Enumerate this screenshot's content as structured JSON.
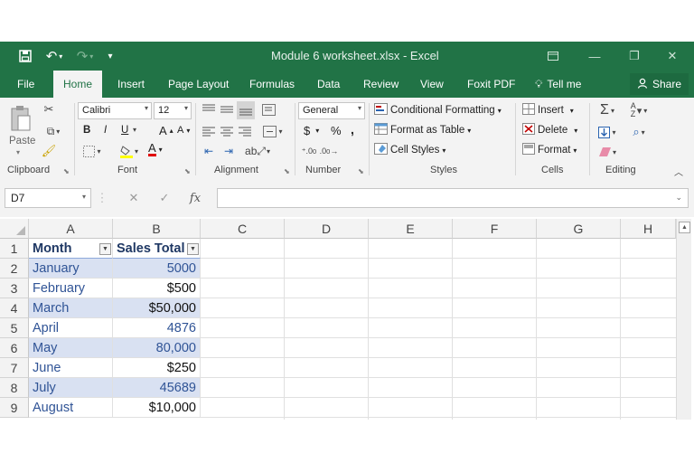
{
  "window": {
    "title": "Module 6 worksheet.xlsx  -  Excel"
  },
  "tabs": [
    "File",
    "Home",
    "Insert",
    "Page Layout",
    "Formulas",
    "Data",
    "Review",
    "View",
    "Foxit PDF"
  ],
  "tell_me": "Tell me",
  "share": "Share",
  "ribbon": {
    "clipboard": {
      "paste": "Paste",
      "label": "Clipboard"
    },
    "font": {
      "name": "Calibri",
      "size": "12",
      "bold": "B",
      "italic": "I",
      "underline": "U",
      "grow": "A",
      "shrink": "A",
      "font_color_letter": "A",
      "label": "Font"
    },
    "alignment": {
      "label": "Alignment"
    },
    "number": {
      "format": "General",
      "currency": "$",
      "percent": "%",
      "comma": ",",
      "label": "Number"
    },
    "styles": {
      "conditional": "Conditional Formatting",
      "format_table": "Format as Table",
      "cell_styles": "Cell Styles",
      "label": "Styles"
    },
    "cells": {
      "insert": "Insert",
      "delete": "Delete",
      "format": "Format",
      "label": "Cells"
    },
    "editing": {
      "label": "Editing"
    }
  },
  "formula_bar": {
    "name_box": "D7",
    "fx": "fx",
    "value": ""
  },
  "sheet": {
    "columns": [
      "A",
      "B",
      "C",
      "D",
      "E",
      "F",
      "G",
      "H"
    ],
    "rows": [
      "1",
      "2",
      "3",
      "4",
      "5",
      "6",
      "7",
      "8",
      "9"
    ],
    "headers": [
      "Month",
      "Sales Total"
    ],
    "data": [
      [
        "January",
        "5000"
      ],
      [
        "February",
        "$500"
      ],
      [
        "March",
        "$50,000"
      ],
      [
        "April",
        "4876"
      ],
      [
        "May",
        "80,000"
      ],
      [
        "June",
        "$250"
      ],
      [
        "July",
        "45689"
      ],
      [
        "August",
        "$10,000"
      ]
    ]
  },
  "colors": {
    "excel_green": "#217346",
    "table_band": "#d9e1f2",
    "table_text": "#305496"
  }
}
